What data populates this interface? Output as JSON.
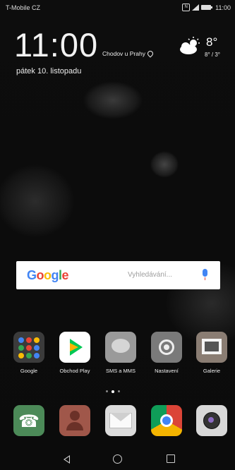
{
  "status": {
    "carrier": "T-Mobile CZ",
    "time": "11:00",
    "nfc": "N"
  },
  "clock": {
    "time": "11:00",
    "date": "pátek 10. listopadu"
  },
  "weather": {
    "location": "Chodov u Prahy",
    "temperature": "8°",
    "range": "8° / 3°",
    "icon": "partly-cloudy-icon"
  },
  "search": {
    "brand": "Google",
    "placeholder": "Vyhledávání..."
  },
  "apps": [
    {
      "label": "Google",
      "icon": "google-folder-icon"
    },
    {
      "label": "Obchod Play",
      "icon": "play-store-icon"
    },
    {
      "label": "SMS a MMS",
      "icon": "messages-icon"
    },
    {
      "label": "Nastavení",
      "icon": "settings-icon"
    },
    {
      "label": "Galerie",
      "icon": "gallery-icon"
    }
  ],
  "page_indicator": {
    "pages": 3,
    "current": 2
  },
  "dock": [
    {
      "icon": "phone-icon"
    },
    {
      "icon": "contacts-icon"
    },
    {
      "icon": "mail-icon"
    },
    {
      "icon": "chrome-icon"
    },
    {
      "icon": "camera-icon"
    }
  ],
  "colors": {
    "google_blue": "#4285f4",
    "google_red": "#ea4335",
    "google_yellow": "#fbbc05",
    "google_green": "#34a853"
  }
}
